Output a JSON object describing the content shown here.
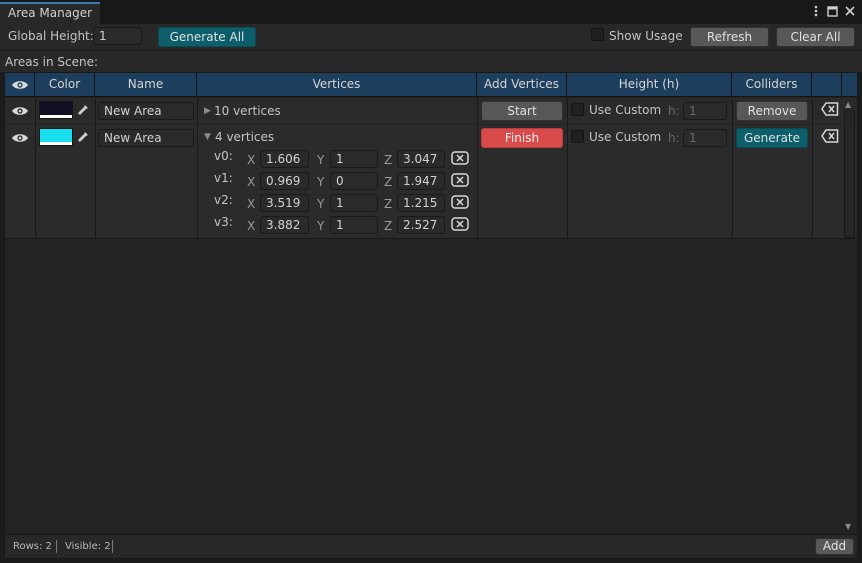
{
  "window": {
    "tab_title": "Area Manager"
  },
  "toolbar": {
    "global_height_label": "Global Height:",
    "global_height_value": "1",
    "generate_all": "Generate All",
    "show_usage": "Show Usage",
    "refresh": "Refresh",
    "clear_all": "Clear All"
  },
  "section": {
    "title": "Areas in Scene:"
  },
  "columns": [
    "Color",
    "Name",
    "Vertices",
    "Add Vertices",
    "Height (h)",
    "Colliders"
  ],
  "rows": [
    {
      "color": "#120e23",
      "name": "New Area",
      "vertices_summary": "10 vertices",
      "add_vertices_button": "Start",
      "use_custom": "Use Custom",
      "h_label": "h:",
      "h_value": "1",
      "collider_button": "Remove"
    },
    {
      "color": "#18dfee",
      "name": "New Area",
      "vertices_summary": "4 vertices",
      "add_vertices_button": "Finish",
      "use_custom": "Use Custom",
      "h_label": "h:",
      "h_value": "1",
      "collider_button": "Generate",
      "axis_labels": {
        "x": "X",
        "y": "Y",
        "z": "Z"
      },
      "vertices": [
        {
          "label": "v0:",
          "x": "1.606",
          "y": "1",
          "z": "3.047"
        },
        {
          "label": "v1:",
          "x": "0.969",
          "y": "0",
          "z": "1.947"
        },
        {
          "label": "v2:",
          "x": "3.519",
          "y": "1",
          "z": "1.215"
        },
        {
          "label": "v3:",
          "x": "3.882",
          "y": "1",
          "z": "2.527"
        }
      ]
    }
  ],
  "footer": {
    "rows": "Rows: 2",
    "visible": "Visible: 2",
    "add": "Add"
  }
}
